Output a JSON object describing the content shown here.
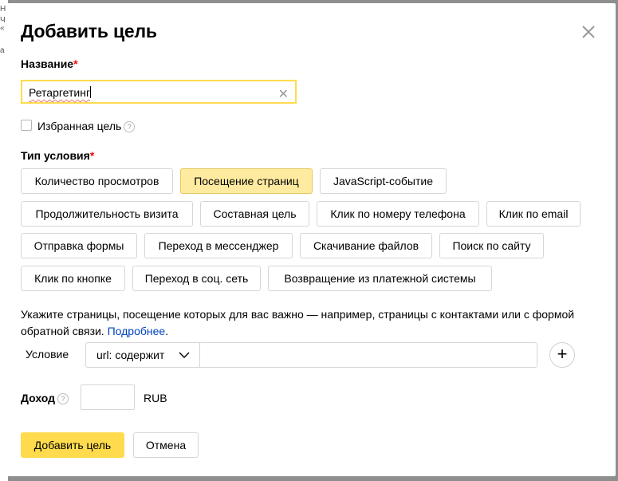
{
  "background_fragments": [
    "Н",
    "Ч",
    "«",
    "а"
  ],
  "dialog": {
    "title": "Добавить цель",
    "close_icon": "close-icon"
  },
  "name_field": {
    "label": "Название",
    "required_mark": "*",
    "value": "Ретаргетинг",
    "clear_icon": "clear-icon"
  },
  "favorite": {
    "label": "Избранная цель",
    "checked": false,
    "help": "?"
  },
  "condition_type": {
    "label": "Тип условия",
    "required_mark": "*",
    "options": [
      "Количество просмотров",
      "Посещение страниц",
      "JavaScript-событие",
      "Продолжительность визита",
      "Составная цель",
      "Клик по номеру телефона",
      "Клик по email",
      "Отправка формы",
      "Переход в мессенджер",
      "Скачивание файлов",
      "Поиск по сайту",
      "Клик по кнопке",
      "Переход в соц. сеть",
      "Возвращение из платежной системы"
    ],
    "selected": "Посещение страниц"
  },
  "hint": {
    "text": "Укажите страницы, посещение которых для вас важно — например, страницы с контактами или с формой обратной связи. ",
    "link": "Подробнее",
    "end": "."
  },
  "condition": {
    "label": "Условие",
    "select_value": "url: содержит",
    "input_value": "",
    "add_icon": "plus-icon"
  },
  "income": {
    "label": "Доход",
    "help": "?",
    "value": "",
    "currency": "RUB"
  },
  "actions": {
    "submit": "Добавить цель",
    "cancel": "Отмена"
  },
  "colors": {
    "accent": "#ffdb4d",
    "selected_option": "#ffeba0",
    "link": "#0044bb",
    "required": "#ff0000"
  }
}
